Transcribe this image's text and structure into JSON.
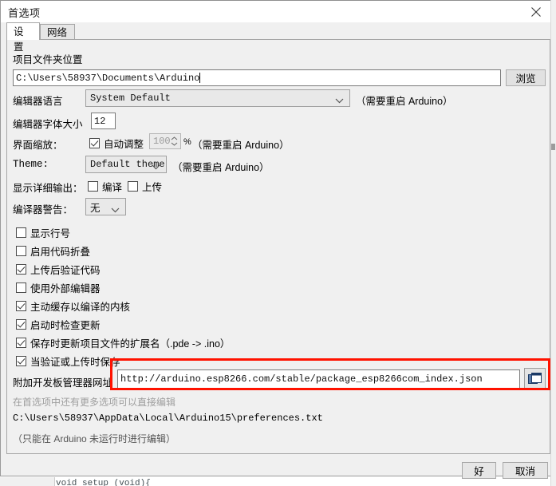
{
  "window": {
    "title": "首选项",
    "close_icon": "close-icon"
  },
  "tabs": [
    {
      "label": "设置",
      "active": true
    },
    {
      "label": "网络",
      "active": false
    }
  ],
  "settings": {
    "sketchbook": {
      "label": "项目文件夹位置",
      "value": "C:\\Users\\58937\\Documents\\Arduino",
      "browse_label": "浏览"
    },
    "editor_language": {
      "label": "编辑器语言",
      "value": "System Default",
      "note": "（需要重启 Arduino）"
    },
    "editor_font_size": {
      "label": "编辑器字体大小",
      "value": "12"
    },
    "interface_scale": {
      "label": "界面缩放：",
      "auto_label": "自动调整",
      "auto_checked": true,
      "percent_value": "100",
      "percent_suffix": "%",
      "note": "（需要重启 Arduino）"
    },
    "theme": {
      "label": "Theme:",
      "value": "Default theme",
      "note": "（需要重启 Arduino）"
    },
    "verbose_output": {
      "label": "显示详细输出：",
      "compile_label": "编译",
      "compile_checked": false,
      "upload_label": "上传",
      "upload_checked": false
    },
    "compiler_warnings": {
      "label": "编译器警告：",
      "value": "无"
    },
    "checkboxes": [
      {
        "label": "显示行号",
        "checked": false
      },
      {
        "label": "启用代码折叠",
        "checked": false
      },
      {
        "label": "上传后验证代码",
        "checked": true
      },
      {
        "label": "使用外部编辑器",
        "checked": false
      },
      {
        "label": "主动缓存以编译的内核",
        "checked": true
      },
      {
        "label": "启动时检查更新",
        "checked": true
      },
      {
        "label": "保存时更新项目文件的扩展名（.pde -> .ino）",
        "checked": true
      },
      {
        "label": "当验证或上传时保存",
        "checked": true
      }
    ],
    "additional_urls": {
      "label": "附加开发板管理器网址",
      "value": "http://arduino.esp8266.com/stable/package_esp8266com_index.json",
      "picker_icon": "window-copy-icon"
    },
    "more_prefs": {
      "hint": "在首选项中还有更多选项可以直接编辑",
      "path": "C:\\Users\\58937\\AppData\\Local\\Arduino15\\preferences.txt",
      "edit_note": "（只能在 Arduino 未运行时进行编辑）"
    }
  },
  "footer": {
    "ok_label": "好",
    "cancel_label": "取消"
  },
  "annotation": {
    "highlight_color": "#ff1200",
    "target": "additional-boards-manager-urls"
  },
  "background": {
    "code_line": "void  setup  (void){"
  }
}
